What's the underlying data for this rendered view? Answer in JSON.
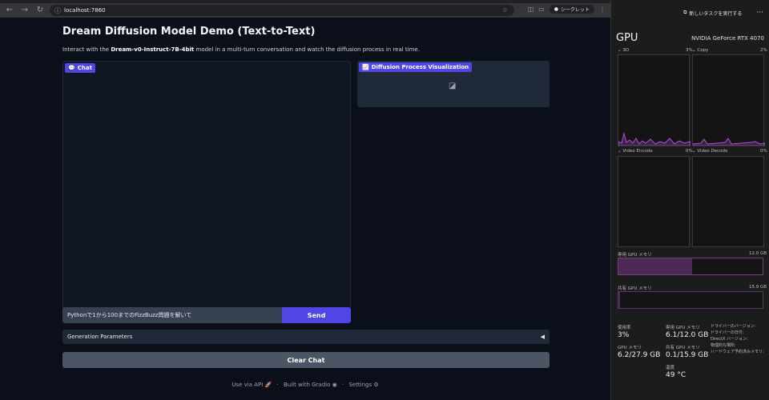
{
  "browser": {
    "url": "localhost:7860",
    "incognito_label": "シークレット",
    "icons": [
      "back-icon",
      "forward-icon",
      "reload-icon",
      "info-icon",
      "star-icon",
      "extension-icon",
      "incognito-icon"
    ]
  },
  "page": {
    "title": "Dream Diffusion Model Demo (Text-to-Text)",
    "subtitle_pre": "Interact with the ",
    "subtitle_model": "Dream-v0-Instruct-7B-4bit",
    "subtitle_post": " model in a multi-turn conversation and watch the diffusion process in real time.",
    "chat_label": "Chat",
    "viz_label": "Diffusion Process Visualization",
    "input_value": "Pythonで1から100までのFizzBuzz問題を解いて",
    "send_label": "Send",
    "accordion_label": "Generation Parameters",
    "clear_label": "Clear Chat",
    "footer": {
      "api": "Use via API",
      "built": "Built with Gradio",
      "settings": "Settings"
    }
  },
  "taskmgr": {
    "new_task": "新しいタスクを実行する",
    "gpu_title": "GPU",
    "gpu_name": "NVIDIA GeForce RTX 4070",
    "graphs": [
      {
        "label": "3D",
        "pct": "3%"
      },
      {
        "label": "Copy",
        "pct": "2%"
      },
      {
        "label": "Video Encode",
        "pct": "0%"
      },
      {
        "label": "Video Decode",
        "pct": "0%"
      }
    ],
    "dedicated_mem_label": "専用 GPU メモリ",
    "dedicated_mem_max": "12.0 GB",
    "shared_mem_label": "共有 GPU メモリ",
    "shared_mem_max": "15.9 GB",
    "dedicated_fill": 0.51,
    "shared_fill": 0.01,
    "stats": {
      "usage_k": "使用率",
      "usage_v": "3%",
      "ded_k": "専用 GPU メモリ",
      "ded_v": "6.1/12.0 GB",
      "gpu_mem_k": "GPU メモリ",
      "gpu_mem_v": "6.2/27.9 GB",
      "shared_k": "共有 GPU メモリ",
      "shared_v": "0.1/15.9 GB",
      "temp_k": "温度",
      "temp_v": "49 °C"
    },
    "side_labels": [
      "ドライバーのバージョン:",
      "ドライバーの日付:",
      "DirectX バージョン:",
      "物理的な場所:",
      "ハードウェア予約済みメモリ:"
    ]
  },
  "colors": {
    "accent": "#4f46e5",
    "graph_line": "#b44fd6"
  }
}
